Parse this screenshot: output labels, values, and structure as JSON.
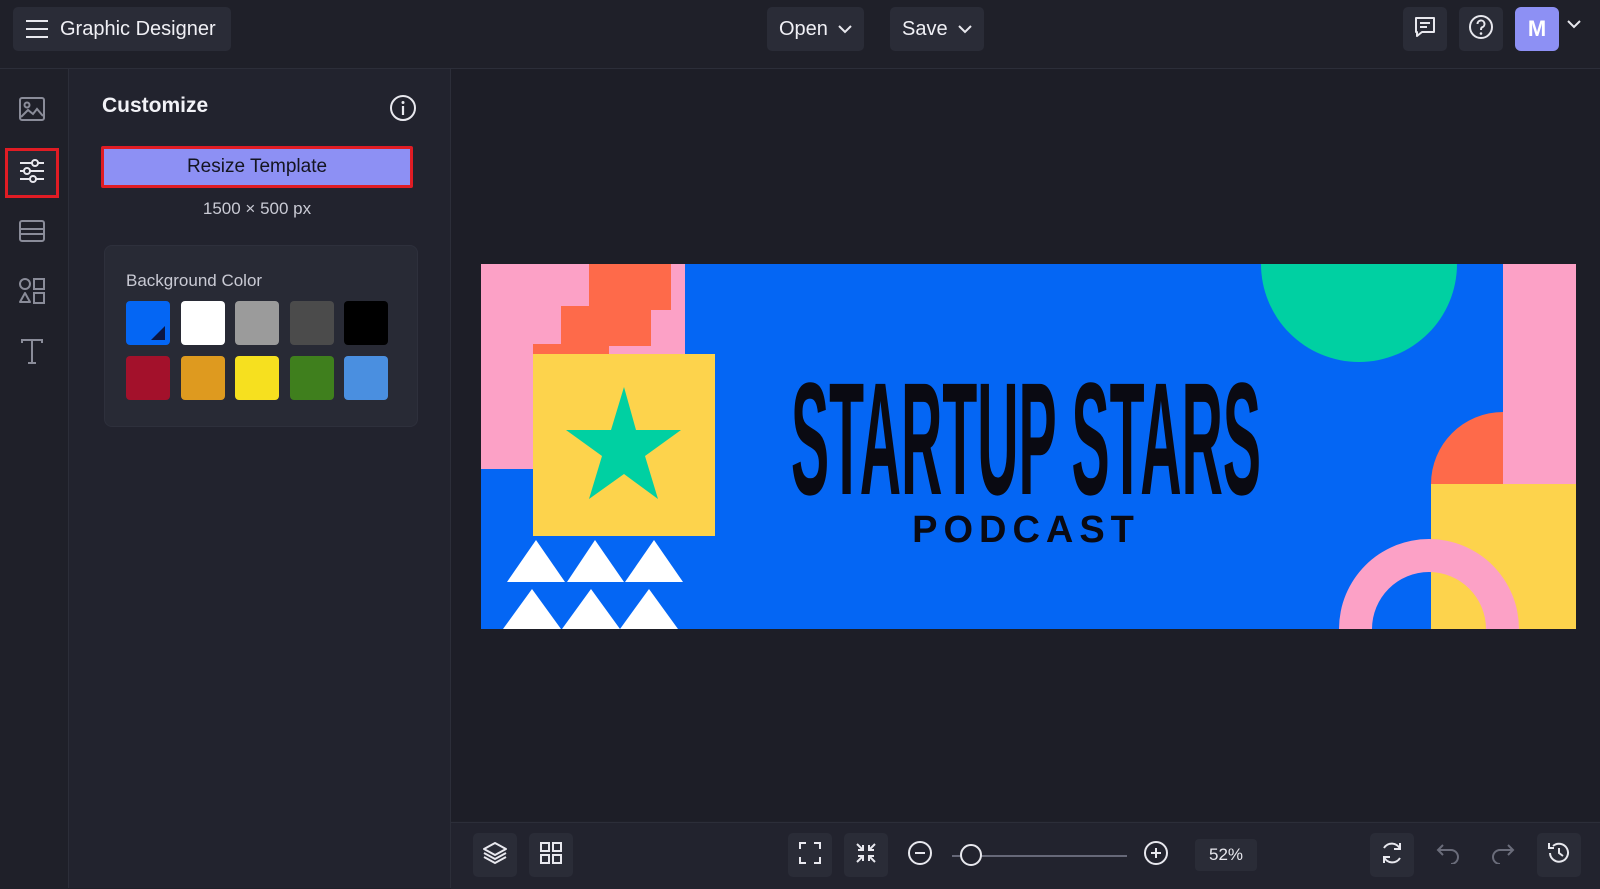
{
  "app": {
    "title": "Graphic Designer"
  },
  "topbar": {
    "open_label": "Open",
    "save_label": "Save",
    "comments_icon": "comment-icon",
    "help_icon": "help-icon",
    "avatar_letter": "M"
  },
  "rail": {
    "items": [
      {
        "icon": "image-icon"
      },
      {
        "icon": "sliders-icon",
        "active": true
      },
      {
        "icon": "layout-icon"
      },
      {
        "icon": "shapes-icon"
      },
      {
        "icon": "text-icon"
      }
    ]
  },
  "panel": {
    "title": "Customize",
    "resize_label": "Resize Template",
    "dimensions": "1500 × 500 px",
    "background_label": "Background Color",
    "swatches": [
      "#0466f4",
      "#ffffff",
      "#9b9b9b",
      "#4b4b4b",
      "#000000",
      "#a3112b",
      "#de9a1f",
      "#f6e01f",
      "#3f7f1d",
      "#4a8fe0"
    ],
    "selected_swatch": "#0466f4"
  },
  "canvas": {
    "headline": "STARTUP STARS",
    "subline": "PODCAST",
    "colors": {
      "blue": "#0466f4",
      "pink": "#fca1c6",
      "orange": "#fe6a4a",
      "yellow": "#fdd34c",
      "teal": "#00d0a2",
      "white": "#ffffff"
    }
  },
  "bottombar": {
    "zoom": "52%",
    "zoom_fraction": 0.52
  },
  "colors": {
    "accent": "#8d90f4",
    "highlight": "#e01c24",
    "bg": "#1f2029"
  }
}
